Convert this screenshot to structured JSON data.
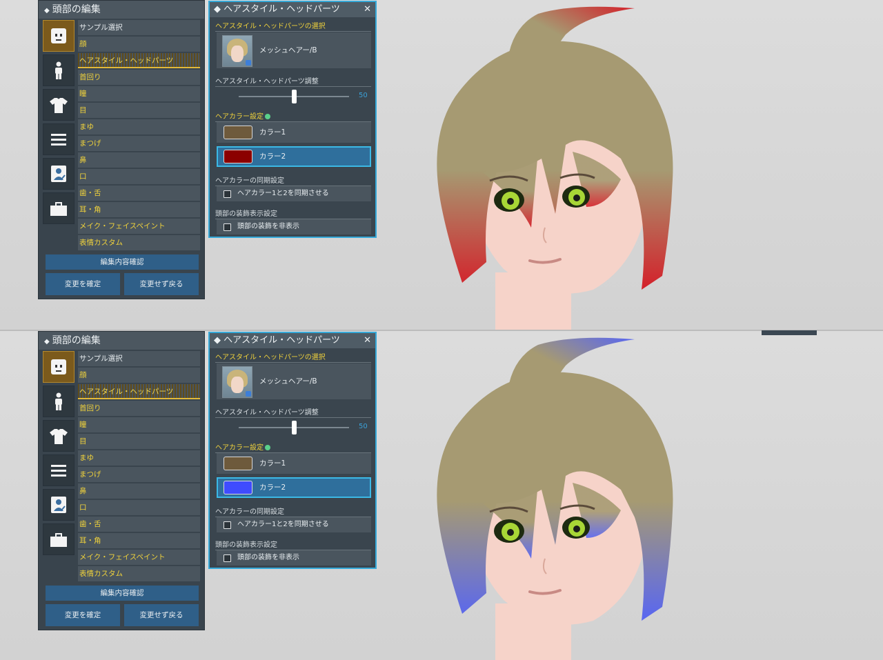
{
  "screens": [
    {
      "edit_panel": {
        "title": "頭部の編集",
        "categories": [
          "face-icon",
          "body-icon",
          "shirt-icon",
          "list-icon",
          "id-card-icon",
          "box-icon"
        ],
        "menu": [
          "サンプル選択",
          "顔",
          "ヘアスタイル・ヘッドパーツ",
          "首回り",
          "瞳",
          "目",
          "まゆ",
          "まつげ",
          "鼻",
          "口",
          "歯・舌",
          "耳・角",
          "メイク・フェイスペイント",
          "表情カスタム"
        ],
        "selected_menu": "ヘアスタイル・ヘッドパーツ",
        "confirm_label": "編集内容確認",
        "apply_label": "変更を確定",
        "cancel_label": "変更せず戻る"
      },
      "hair_panel": {
        "title": "ヘアスタイル・ヘッドパーツ",
        "close_glyph": "✕",
        "select_label": "ヘアスタイル・ヘッドパーツの選択",
        "hair_name": "メッシュヘアー/B",
        "adjust_label": "ヘアスタイル・ヘッドパーツ調整",
        "slider_value": "50",
        "slider_fraction": 0.5,
        "color_label": "ヘアカラー設定",
        "color1_label": "カラー1",
        "color1_hex": "#6e5a3c",
        "color2_label": "カラー2",
        "color2_hex": "#8b0000",
        "sync_label": "ヘアカラーの同期設定",
        "sync_checkbox": "ヘアカラー1と2を同期させる",
        "decor_label": "頭部の装飾表示設定",
        "decor_checkbox": "頭部の装飾を非表示"
      },
      "hair_tip_color": "#d4202a"
    },
    {
      "edit_panel": {
        "title": "頭部の編集",
        "categories": [
          "face-icon",
          "body-icon",
          "shirt-icon",
          "list-icon",
          "id-card-icon",
          "box-icon"
        ],
        "menu": [
          "サンプル選択",
          "顔",
          "ヘアスタイル・ヘッドパーツ",
          "首回り",
          "瞳",
          "目",
          "まゆ",
          "まつげ",
          "鼻",
          "口",
          "歯・舌",
          "耳・角",
          "メイク・フェイスペイント",
          "表情カスタム"
        ],
        "selected_menu": "ヘアスタイル・ヘッドパーツ",
        "confirm_label": "編集内容確認",
        "apply_label": "変更を確定",
        "cancel_label": "変更せず戻る"
      },
      "hair_panel": {
        "title": "ヘアスタイル・ヘッドパーツ",
        "close_glyph": "✕",
        "select_label": "ヘアスタイル・ヘッドパーツの選択",
        "hair_name": "メッシュヘアー/B",
        "adjust_label": "ヘアスタイル・ヘッドパーツ調整",
        "slider_value": "50",
        "slider_fraction": 0.5,
        "color_label": "ヘアカラー設定",
        "color1_label": "カラー1",
        "color1_hex": "#6e5a3c",
        "color2_label": "カラー2",
        "color2_hex": "#3f4cff",
        "sync_label": "ヘアカラーの同期設定",
        "sync_checkbox": "ヘアカラー1と2を同期させる",
        "decor_label": "頭部の装飾表示設定",
        "decor_checkbox": "頭部の装飾を非表示"
      },
      "hair_tip_color": "#5866f2"
    }
  ],
  "colors": {
    "base_hair": "#a69a72",
    "skin": "#f6d3c9",
    "eye": "#a8d636"
  }
}
